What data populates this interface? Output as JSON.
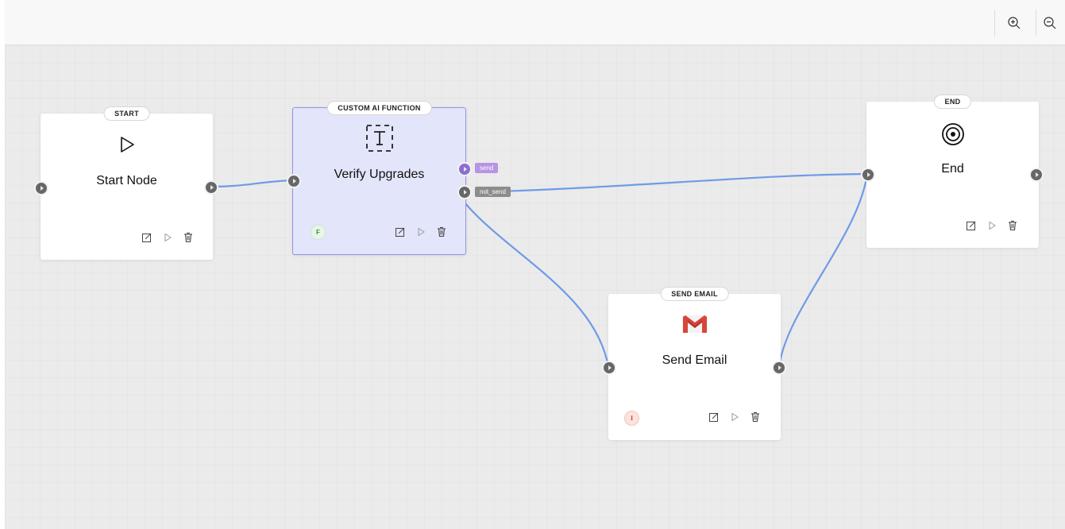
{
  "colors": {
    "edge": "#6f9be8",
    "port": "#676767",
    "port_purple": "#8a6fd0",
    "selected_bg": "#e3e5fb",
    "selected_border": "#8f95e6",
    "gmail_red": "#d9453a",
    "label_send_bg": "#b894e4",
    "label_not_send_bg": "#8c8c8c"
  },
  "toolbar": {
    "zoom_in_icon": "zoom-in-icon",
    "zoom_out_icon": "zoom-out-icon"
  },
  "nodes": {
    "start": {
      "type": "START",
      "title": "Start Node",
      "icon": "play-icon"
    },
    "custom_ai": {
      "type": "CUSTOM AI FUNCTION",
      "title": "Verify Upgrades",
      "icon": "text-box-icon",
      "badge": "F"
    },
    "end": {
      "type": "END",
      "title": "End",
      "icon": "target-icon"
    },
    "send_email": {
      "type": "SEND EMAIL",
      "title": "Send Email",
      "icon": "gmail-icon",
      "badge": "I"
    }
  },
  "edge_labels": {
    "send": "send",
    "not_send": "not_send"
  }
}
